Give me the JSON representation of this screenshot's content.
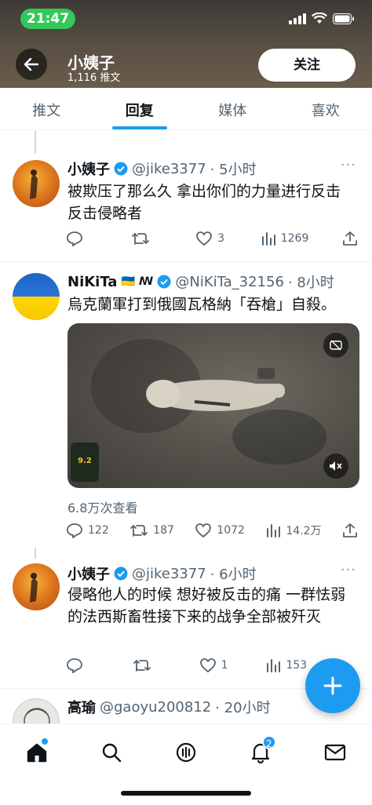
{
  "status_bar": {
    "time": "21:47"
  },
  "profile_header": {
    "name": "小姨子",
    "post_count": "1,116 推文",
    "follow_label": "关注"
  },
  "tabs": [
    {
      "label": "推文",
      "active": false
    },
    {
      "label": "回复",
      "active": true
    },
    {
      "label": "媒体",
      "active": false
    },
    {
      "label": "喜欢",
      "active": false
    }
  ],
  "tweets": [
    {
      "name": "小姨子",
      "handle": "@jike3377",
      "time": "· 5小时",
      "verified": true,
      "text": "被欺压了那么久 拿出你们的力量进行反击 反击侵略者",
      "replies": "",
      "retweets": "",
      "likes": "3",
      "views": "1269"
    },
    {
      "name": "NiKiTa",
      "name_suffix": "🇺🇦 ꟿ",
      "handle": "@NiKiTa_32156",
      "time": "· 8小时",
      "verified": true,
      "text": "烏克蘭軍打到俄國瓦格納「吞槍」自殺。",
      "patch_label": "9.2",
      "view_count": "6.8万次查看",
      "replies": "122",
      "retweets": "187",
      "likes": "1072",
      "views": "14.2万"
    },
    {
      "name": "小姨子",
      "handle": "@jike3377",
      "time": "· 6小时",
      "verified": true,
      "text": "侵略他人的时候 想好被反击的痛 一群怯弱的法西斯畜牲接下来的战争全部被歼灭",
      "replies": "",
      "retweets": "",
      "likes": "1",
      "views": "153"
    },
    {
      "name": "高瑜",
      "handle": "@gaoyu200812",
      "time": "· 20小时"
    }
  ],
  "bottom_nav": {
    "notifications_badge": "2"
  },
  "colors": {
    "accent": "#1d9bf0",
    "text_primary": "#0f1419",
    "text_secondary": "#536471",
    "status_time_pill": "#34c759"
  }
}
